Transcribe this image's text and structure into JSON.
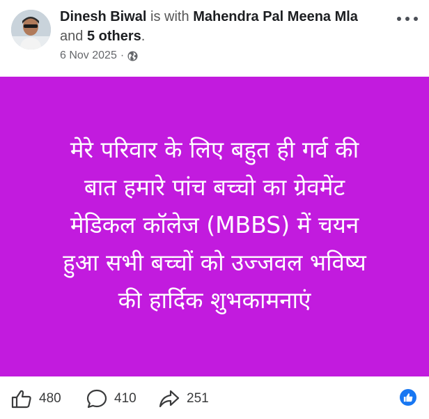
{
  "post": {
    "author": "Dinesh Biwal",
    "with_text": "is with",
    "tagged": "Mahendra Pal Meena Mla",
    "and_text": "and",
    "others": "5 others",
    "period": ".",
    "date": "6 Nov 2025",
    "separator": "·",
    "privacy_icon": "globe-icon",
    "text_lines": [
      "मेरे परिवार के लिए बहुत ही गर्व की",
      "बात हमारे पांच बच्चो का ग्रेवमेंट",
      "मेडिकल कॉलेज (MBBS) में चयन",
      "हुआ सभी बच्चों को उज्जवल भविष्य",
      "की हार्दिक शुभकामनाएं"
    ],
    "background_color": "#c21bde"
  },
  "stats": {
    "likes": "480",
    "comments": "410",
    "shares": "251"
  },
  "icons": {
    "more": "more-options-icon",
    "like": "thumbs-up-icon",
    "comment": "comment-icon",
    "share": "share-icon",
    "reaction": "like-reaction-icon"
  },
  "colors": {
    "accent": "#1877f2",
    "post_background": "#c21bde"
  }
}
